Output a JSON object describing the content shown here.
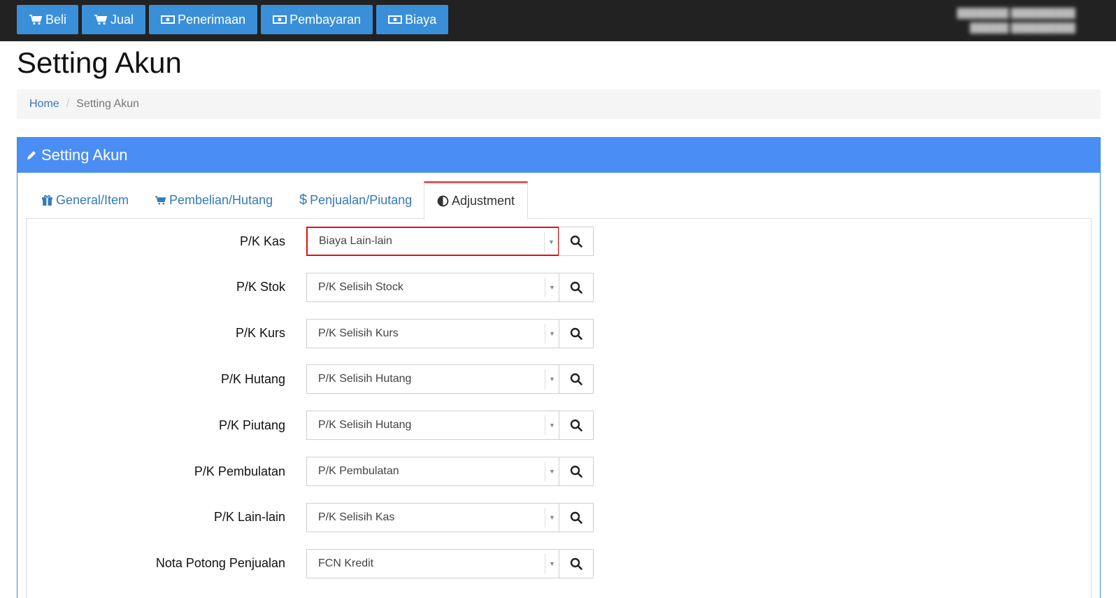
{
  "topnav": [
    {
      "label": "Beli",
      "icon": "cart-icon"
    },
    {
      "label": "Jual",
      "icon": "cart-icon"
    },
    {
      "label": "Penerimaan",
      "icon": "money-icon"
    },
    {
      "label": "Pembayaran",
      "icon": "money-icon"
    },
    {
      "label": "Biaya",
      "icon": "money-icon"
    }
  ],
  "page_title": "Setting Akun",
  "breadcrumb": {
    "home": "Home",
    "current": "Setting Akun"
  },
  "panel": {
    "title": "Setting Akun"
  },
  "tabs": [
    {
      "label": "General/Item",
      "icon": "gift-icon",
      "active": false
    },
    {
      "label": "Pembelian/Hutang",
      "icon": "cart-icon",
      "active": false
    },
    {
      "label": "Penjualan/Piutang",
      "icon": "dollar-icon",
      "active": false
    },
    {
      "label": "Adjustment",
      "icon": "adjust-icon",
      "active": true
    }
  ],
  "fields": [
    {
      "label": "P/K Kas",
      "value": "Biaya Lain-lain"
    },
    {
      "label": "P/K Stok",
      "value": "P/K Selisih Stock"
    },
    {
      "label": "P/K Kurs",
      "value": "P/K Selisih Kurs"
    },
    {
      "label": "P/K Hutang",
      "value": "P/K Selisih Hutang"
    },
    {
      "label": "P/K Piutang",
      "value": "P/K Selisih Hutang"
    },
    {
      "label": "P/K Pembulatan",
      "value": "P/K Pembulatan"
    },
    {
      "label": "P/K Lain-lain",
      "value": "P/K Selisih Kas"
    },
    {
      "label": "Nota Potong Penjualan",
      "value": "FCN Kredit"
    }
  ],
  "colors": {
    "topbar": "#222222",
    "nav_button": "#3a8fd9",
    "panel_heading": "#4a8ef5",
    "active_tab_border": "#e05a5a",
    "highlight_border": "#e01010",
    "link": "#337ab7"
  }
}
